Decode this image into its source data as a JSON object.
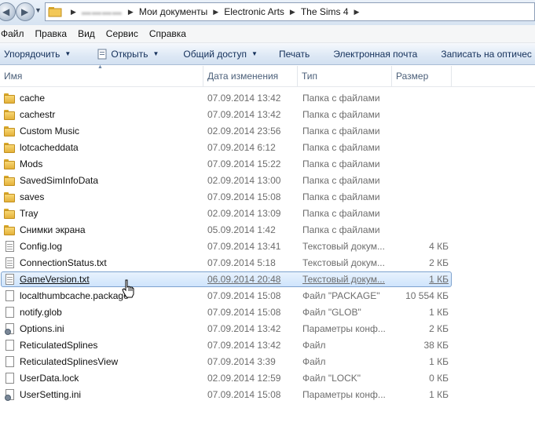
{
  "address": {
    "crumbs": [
      "▬▬▬▬",
      "Мои документы",
      "Electronic Arts",
      "The Sims 4"
    ]
  },
  "menu": [
    "Файл",
    "Правка",
    "Вид",
    "Сервис",
    "Справка"
  ],
  "toolbar": {
    "organize": "Упорядочить",
    "open": "Открыть",
    "share": "Общий доступ",
    "print": "Печать",
    "email": "Электронная почта",
    "burn": "Записать на оптичес"
  },
  "columns": {
    "name": "Имя",
    "date": "Дата изменения",
    "type": "Тип",
    "size": "Размер"
  },
  "files": [
    {
      "name": "cache",
      "date": "07.09.2014 13:42",
      "type": "Папка с файлами",
      "size": "",
      "icon": "folder-icon"
    },
    {
      "name": "cachestr",
      "date": "07.09.2014 13:42",
      "type": "Папка с файлами",
      "size": "",
      "icon": "folder-icon"
    },
    {
      "name": "Custom Music",
      "date": "02.09.2014 23:56",
      "type": "Папка с файлами",
      "size": "",
      "icon": "folder-icon"
    },
    {
      "name": "lotcacheddata",
      "date": "07.09.2014 6:12",
      "type": "Папка с файлами",
      "size": "",
      "icon": "folder-icon"
    },
    {
      "name": "Mods",
      "date": "07.09.2014 15:22",
      "type": "Папка с файлами",
      "size": "",
      "icon": "folder-icon"
    },
    {
      "name": "SavedSimInfoData",
      "date": "02.09.2014 13:00",
      "type": "Папка с файлами",
      "size": "",
      "icon": "folder-icon"
    },
    {
      "name": "saves",
      "date": "07.09.2014 15:08",
      "type": "Папка с файлами",
      "size": "",
      "icon": "folder-icon"
    },
    {
      "name": "Tray",
      "date": "02.09.2014 13:09",
      "type": "Папка с файлами",
      "size": "",
      "icon": "folder-icon"
    },
    {
      "name": "Снимки экрана",
      "date": "05.09.2014 1:42",
      "type": "Папка с файлами",
      "size": "",
      "icon": "folder-icon"
    },
    {
      "name": "Config.log",
      "date": "07.09.2014 13:41",
      "type": "Текстовый докум...",
      "size": "4 КБ",
      "icon": "text-file-icon"
    },
    {
      "name": "ConnectionStatus.txt",
      "date": "07.09.2014 5:18",
      "type": "Текстовый докум...",
      "size": "2 КБ",
      "icon": "text-file-icon"
    },
    {
      "name": "GameVersion.txt",
      "date": "06.09.2014 20:48",
      "type": "Текстовый докум...",
      "size": "1 КБ",
      "icon": "text-file-icon",
      "selected": true
    },
    {
      "name": "localthumbcache.package",
      "date": "07.09.2014 15:08",
      "type": "Файл \"PACKAGE\"",
      "size": "10 554 КБ",
      "icon": "blank-file-icon"
    },
    {
      "name": "notify.glob",
      "date": "07.09.2014 15:08",
      "type": "Файл \"GLOB\"",
      "size": "1 КБ",
      "icon": "blank-file-icon"
    },
    {
      "name": "Options.ini",
      "date": "07.09.2014 13:42",
      "type": "Параметры конф...",
      "size": "2 КБ",
      "icon": "settings-file-icon"
    },
    {
      "name": "ReticulatedSplines",
      "date": "07.09.2014 13:42",
      "type": "Файл",
      "size": "38 КБ",
      "icon": "blank-file-icon"
    },
    {
      "name": "ReticulatedSplinesView",
      "date": "07.09.2014 3:39",
      "type": "Файл",
      "size": "1 КБ",
      "icon": "blank-file-icon"
    },
    {
      "name": "UserData.lock",
      "date": "02.09.2014 12:59",
      "type": "Файл \"LOCK\"",
      "size": "0 КБ",
      "icon": "blank-file-icon"
    },
    {
      "name": "UserSetting.ini",
      "date": "07.09.2014 15:08",
      "type": "Параметры конф...",
      "size": "1 КБ",
      "icon": "settings-file-icon"
    }
  ]
}
